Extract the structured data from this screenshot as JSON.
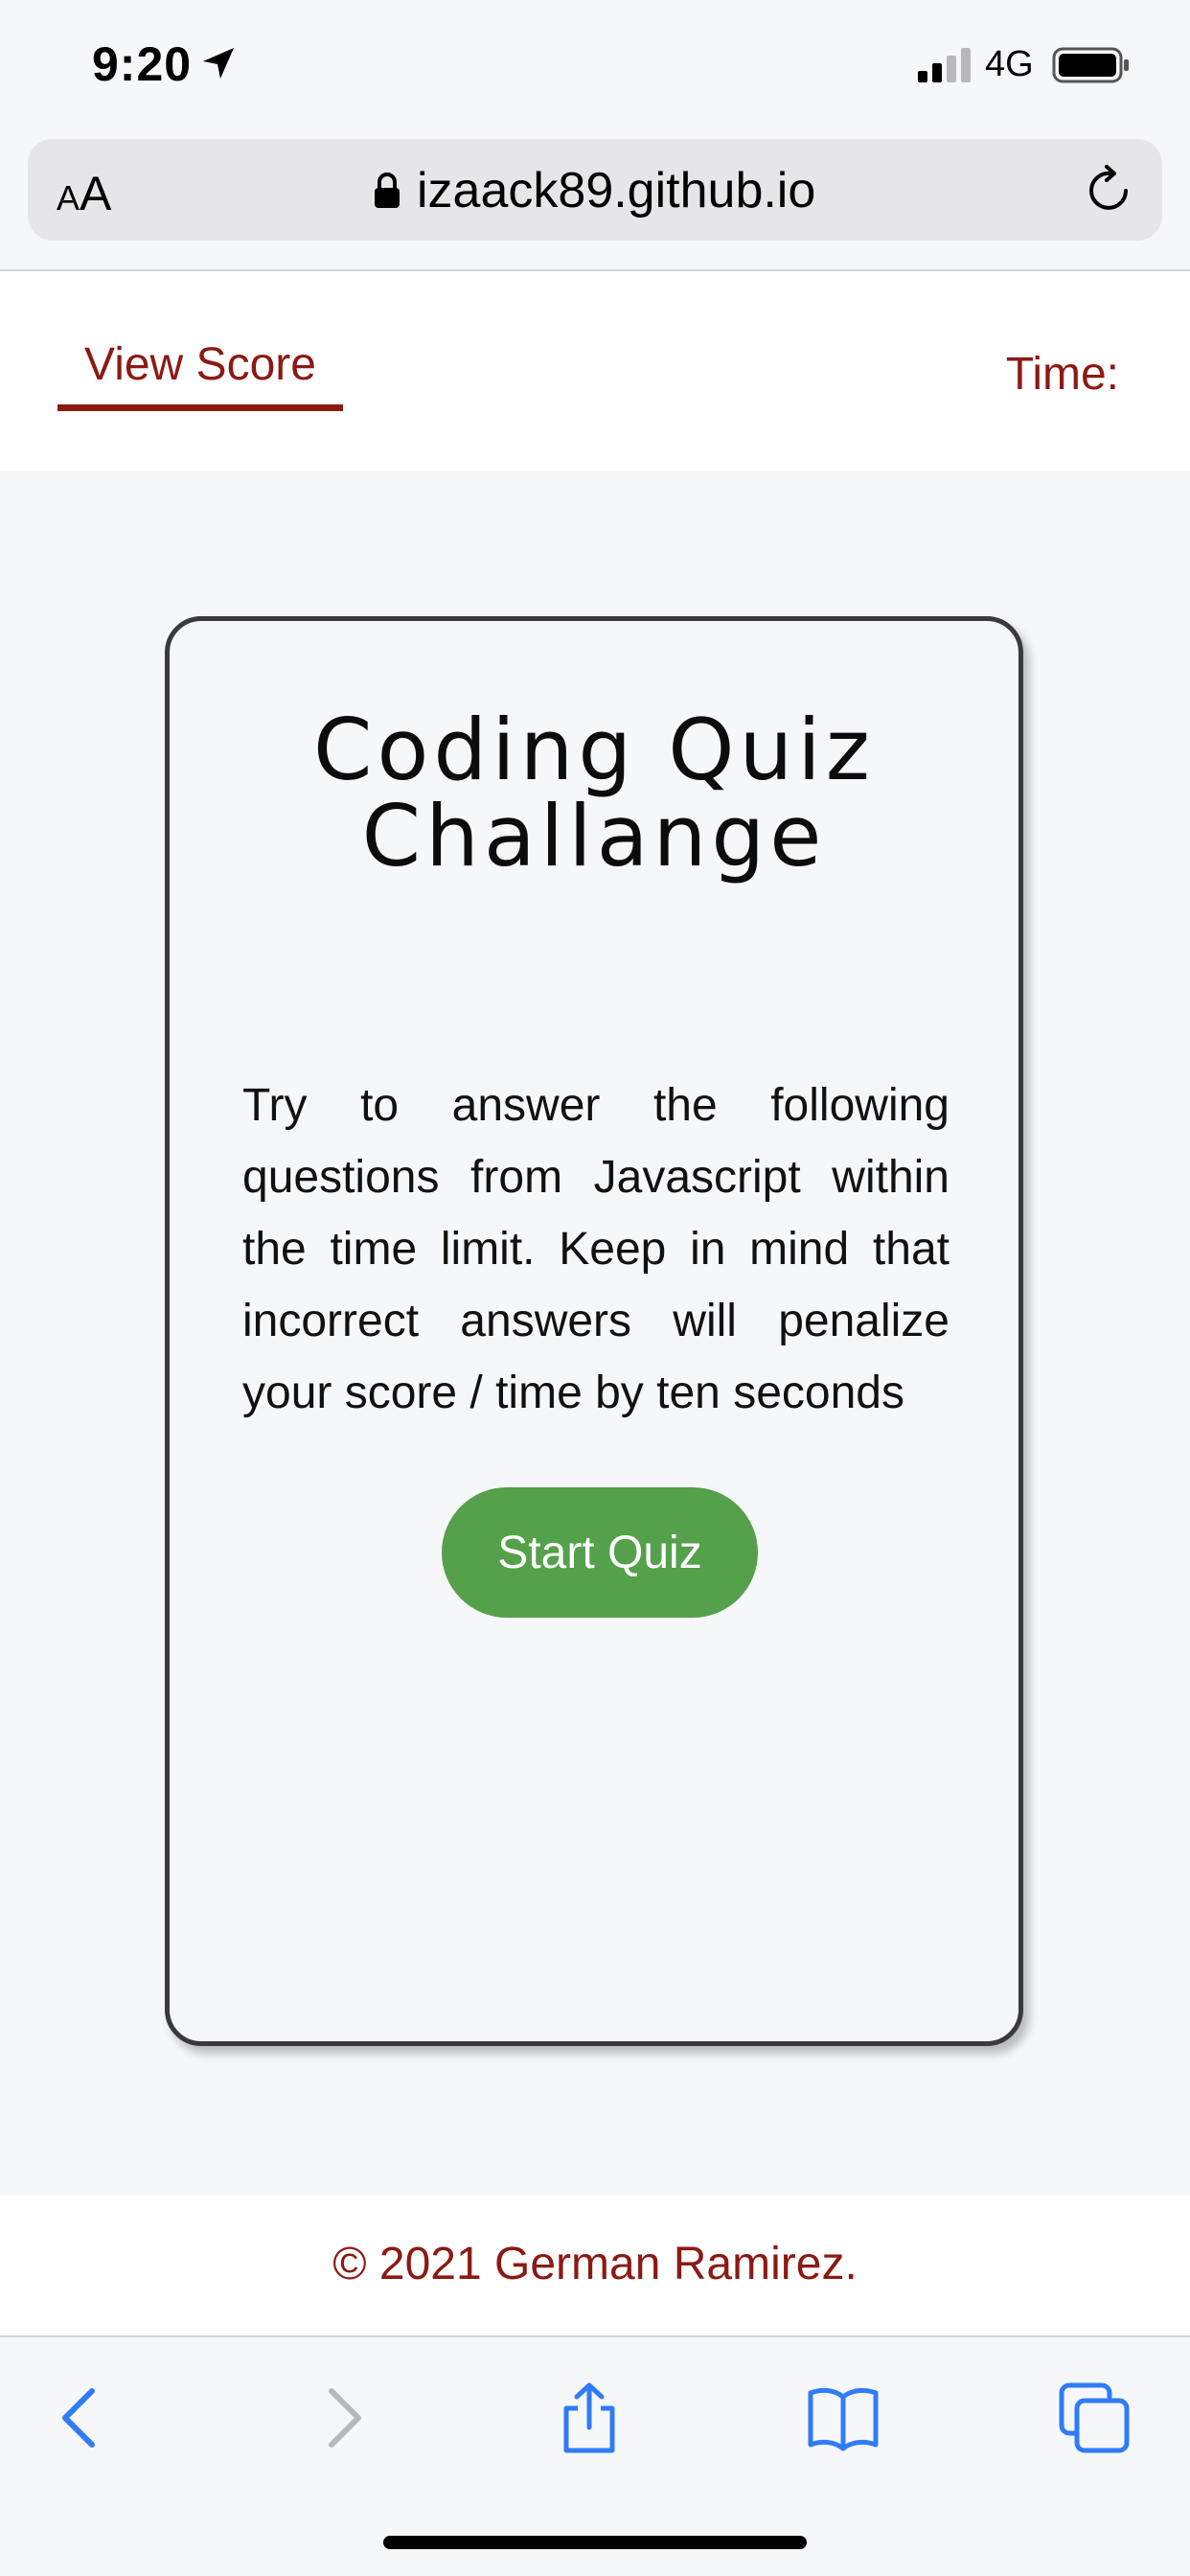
{
  "status_bar": {
    "time": "9:20",
    "network": "4G",
    "icons": [
      "location-arrow-icon",
      "signal-icon",
      "battery-icon"
    ]
  },
  "browser": {
    "text_size_label_small": "A",
    "text_size_label_big": "A",
    "url": "izaack89.github.io",
    "icons": [
      "lock-icon",
      "reload-icon"
    ]
  },
  "header": {
    "view_score": "View Score",
    "timer_label": "Time:"
  },
  "card": {
    "title": "Coding Quiz Challange",
    "description": "Try to answer the following questions from Javascript within the time limit. Keep in mind that incorrect answers will penalize your score / time by ten seconds",
    "start_button": "Start Quiz"
  },
  "footer": {
    "copyright": "© 2021 German Ramirez."
  },
  "toolbar": {
    "icons": [
      "back-icon",
      "forward-icon",
      "share-icon",
      "bookmarks-icon",
      "tabs-icon"
    ]
  },
  "colors": {
    "accent": "#8b1a13",
    "button": "#55a04a",
    "ios_blue": "#2f7cf6"
  }
}
